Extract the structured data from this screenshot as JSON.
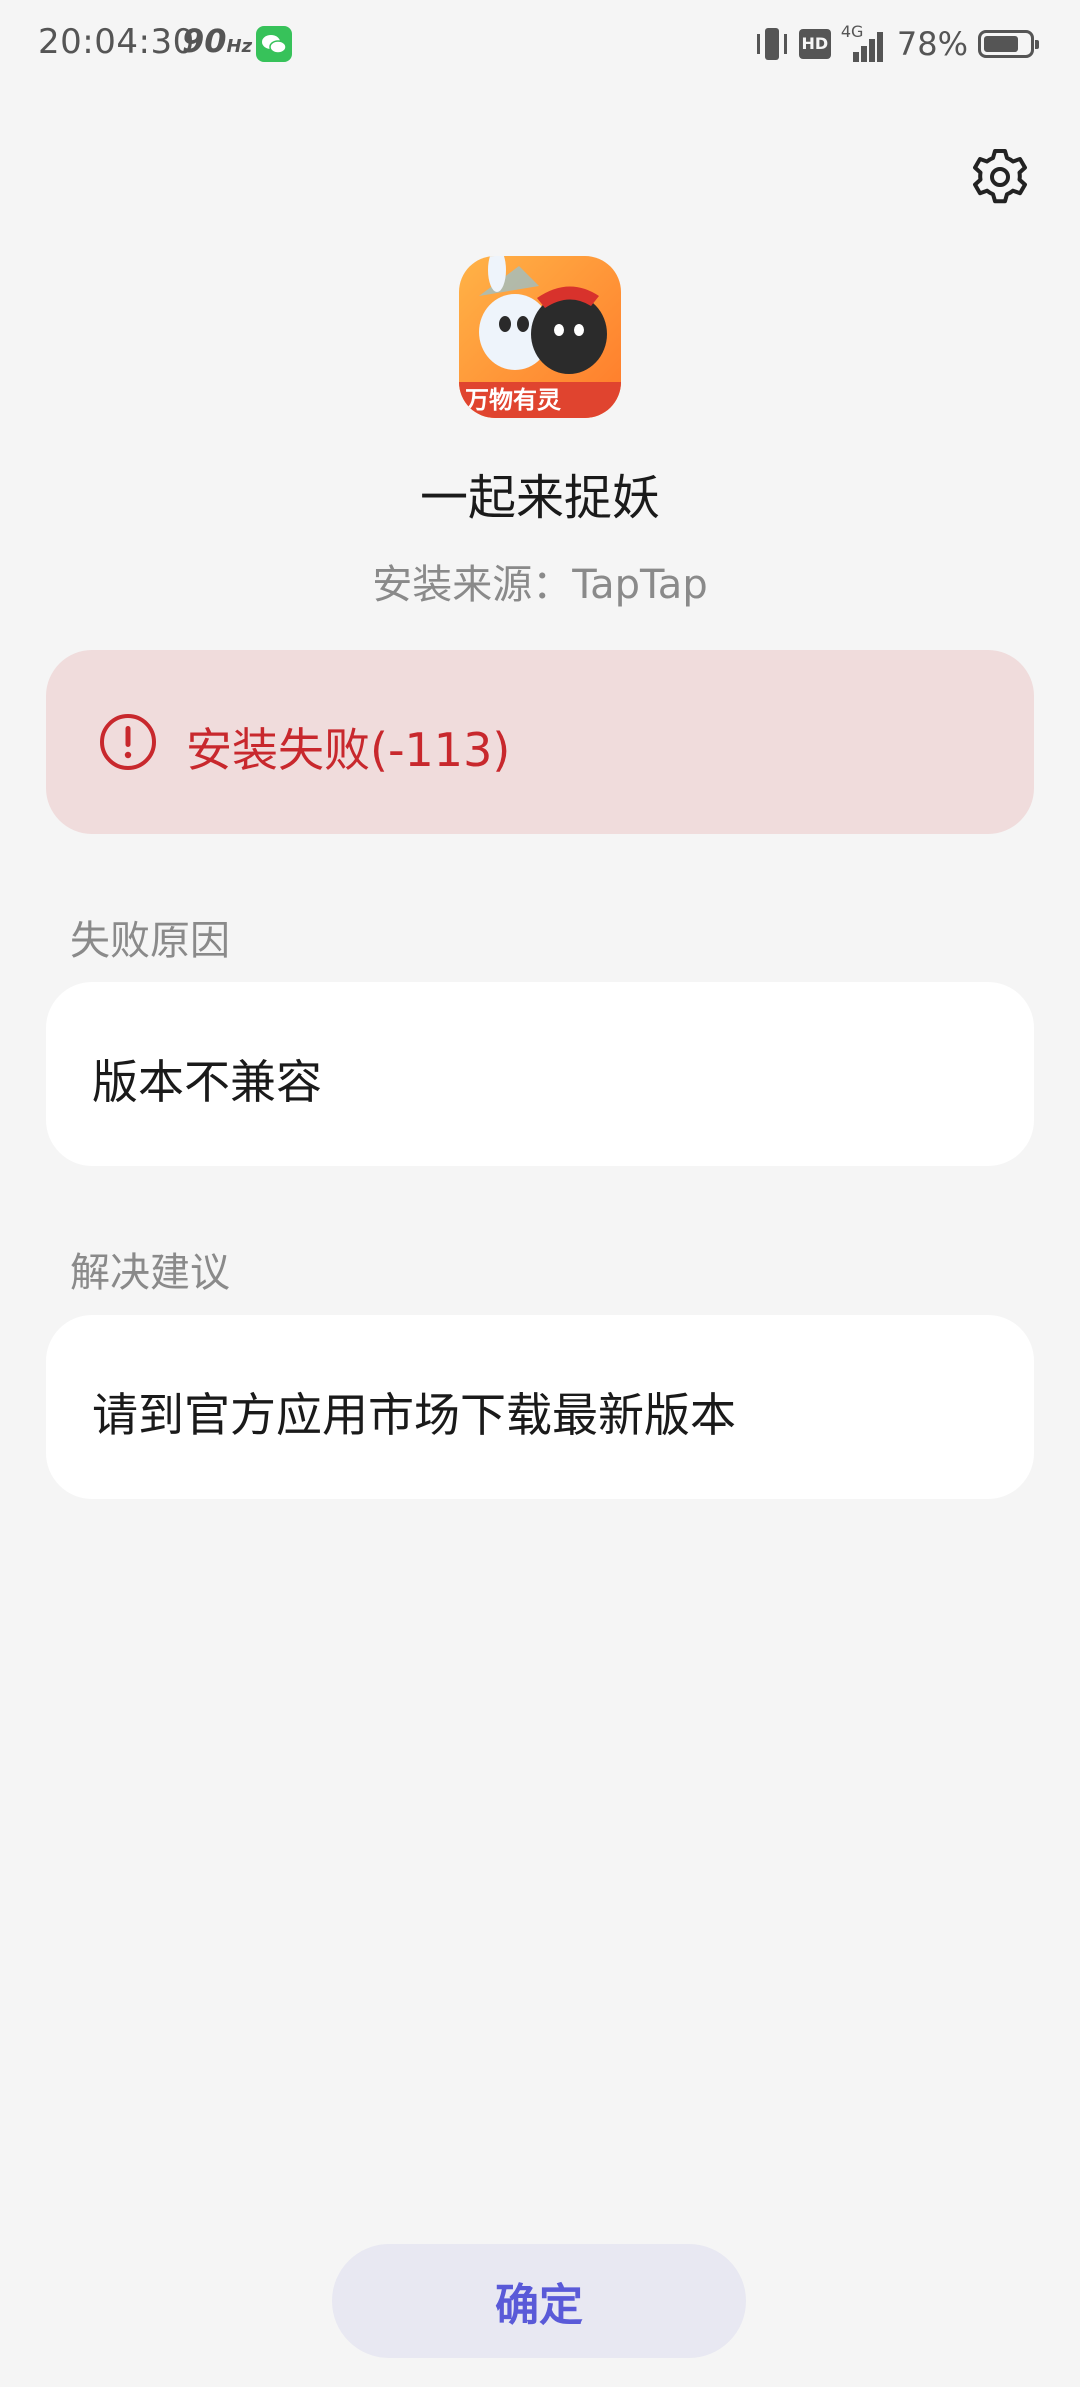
{
  "status_bar": {
    "time": "20:04:30",
    "refresh_rate": "90",
    "refresh_unit": "Hz",
    "hd_label": "HD",
    "network": "4G",
    "battery_percent": "78%",
    "battery_level": 0.78
  },
  "app": {
    "name": "一起来捉妖",
    "install_source": "安装来源：TapTap",
    "icon_text": "万物有灵"
  },
  "error": {
    "message": "安装失败(-113)",
    "color": "#c8282d"
  },
  "failure_reason": {
    "label": "失败原因",
    "text": "版本不兼容"
  },
  "suggestion": {
    "label": "解决建议",
    "text": "请到官方应用市场下载最新版本"
  },
  "confirm": {
    "label": "确定"
  }
}
